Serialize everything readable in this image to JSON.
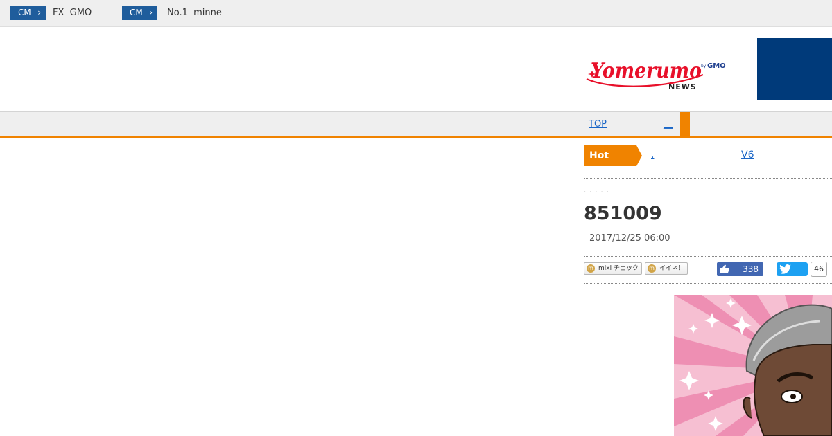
{
  "top_ads": [
    {
      "badge": "CM",
      "text": "FX  GMO"
    },
    {
      "badge": "CM",
      "text": "No.1  minne"
    }
  ],
  "logo": {
    "main": "Yomerumo",
    "sub": "NEWS",
    "by": "by",
    "brand": "GMO"
  },
  "nav": {
    "top_label": "TOP",
    "second_label": "__"
  },
  "hot": {
    "label": "Hot",
    "items": [
      ".",
      "V6"
    ]
  },
  "article": {
    "dots": ".....",
    "title": "851009",
    "date": "2017/12/25 06:00"
  },
  "share": {
    "mixi_check": "mixi チェック",
    "mixi_like": "イイネ！",
    "fb_count": "338",
    "tw_count": "46"
  },
  "colors": {
    "accent_orange": "#f08300",
    "cm_badge_blue": "#1f5d9c",
    "header_ad_navy": "#003a7a",
    "link_blue": "#1a66c7",
    "facebook_blue": "#4267b2",
    "twitter_blue": "#1da1f2",
    "logo_red": "#e8102a"
  },
  "icons": {
    "cm_chevron": "chevron-right-icon",
    "mixi": "mixi-icon",
    "facebook": "thumbs-up-icon",
    "twitter": "twitter-bird-icon"
  }
}
